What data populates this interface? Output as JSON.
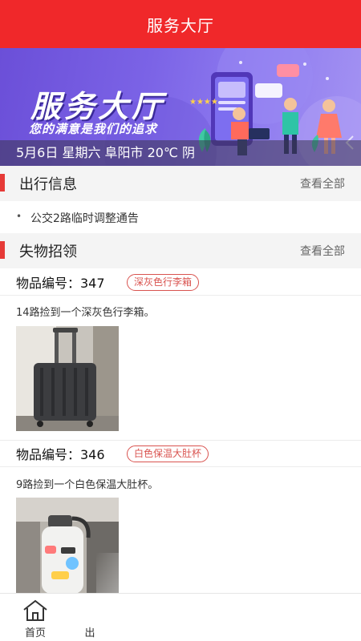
{
  "header": {
    "title": "服务大厅"
  },
  "banner": {
    "title": "服务大厅",
    "subtitle": "您的满意是我们的追求",
    "info": "5月6日 星期六 阜阳市 20℃ 阴"
  },
  "travel": {
    "title": "出行信息",
    "more": "查看全部",
    "items": [
      {
        "text": "公交2路临时调整通告"
      }
    ]
  },
  "lost_found": {
    "title": "失物招领",
    "more": "查看全部",
    "items": [
      {
        "label": "物品编号：347",
        "tag": "深灰色行李箱",
        "desc": "14路捡到一个深灰色行李箱。",
        "photo": "dark-gray-suitcase"
      },
      {
        "label": "物品编号：346",
        "tag": "白色保温大肚杯",
        "desc": "9路捡到一个白色保温大肚杯。",
        "photo": "white-thermos-cup"
      }
    ]
  },
  "tabbar": {
    "tabs": [
      {
        "label": "首页",
        "icon": "home-icon"
      },
      {
        "label": "出",
        "icon": "bus-icon"
      }
    ]
  },
  "colors": {
    "header": "#f0282a",
    "accent": "#e63a37",
    "tag": "#d9534f",
    "banner": "#7b63e6"
  }
}
